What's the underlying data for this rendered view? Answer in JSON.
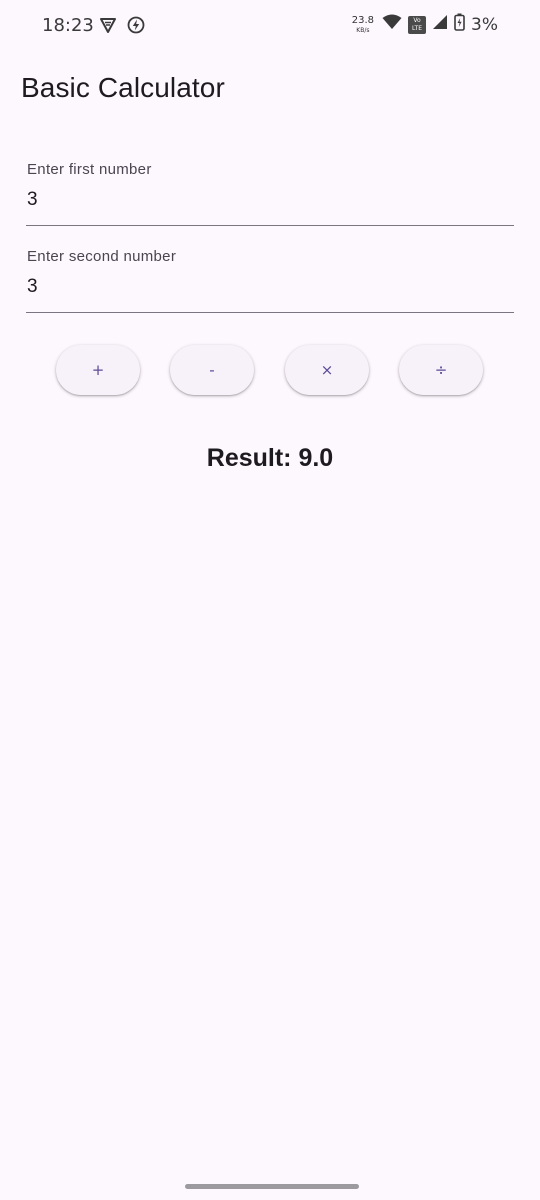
{
  "status_bar": {
    "time": "18:23",
    "net_speed_value": "23.8",
    "net_speed_unit": "KB/s",
    "volte_top": "Vo",
    "volte_bottom": "LTE",
    "battery_percent": "3%"
  },
  "app_bar": {
    "title": "Basic Calculator"
  },
  "inputs": {
    "first": {
      "label": "Enter first number",
      "value": "3"
    },
    "second": {
      "label": "Enter second number",
      "value": "3"
    }
  },
  "operations": {
    "add": "+",
    "subtract": "-",
    "multiply": "×",
    "divide": "÷"
  },
  "result": {
    "text": "Result: 9.0"
  },
  "colors": {
    "background": "#fdf7fe",
    "button_bg": "#f7f2fa",
    "button_text": "#5d4a96"
  }
}
